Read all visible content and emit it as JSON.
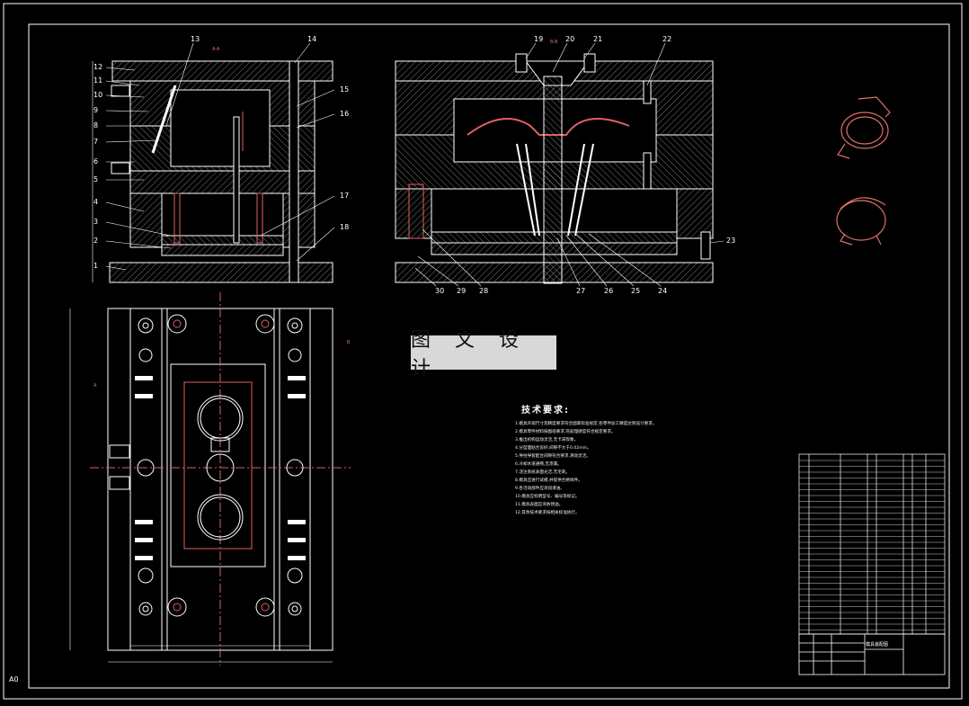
{
  "watermark": "图 文 设 计",
  "tech_requirements": {
    "title": "技术要求:",
    "items": [
      "1.模具外观尺寸及精度要求符合国家标准规定,各零件加工精度达到设计要求。",
      "2.模具零件材料按图纸要求,热处理硬度符合规定要求。",
      "3.推出机构运动灵活,无卡滞现象。",
      "4.分型面贴合良好,间隙不大于0.02mm。",
      "5.导柱导套配合间隙符合要求,滑动灵活。",
      "6.冷却水道通畅,无渗漏。",
      "7.浇注系统表面光洁,无毛刺。",
      "8.模具应进行试模,并提供合格样件。",
      "9.各活动部件应涂润滑油。",
      "10.模具应标明型号、编号等标记。",
      "11.模具表面应涂防锈油。",
      "12.其余技术要求按相关标准执行。"
    ]
  },
  "part_labels_top_left": [
    "1",
    "2",
    "3",
    "4",
    "5",
    "6",
    "7",
    "8",
    "9",
    "10",
    "11",
    "12",
    "13",
    "14",
    "15",
    "16",
    "17",
    "18"
  ],
  "part_labels_top_right": [
    "19",
    "20",
    "21",
    "22",
    "23",
    "24",
    "25",
    "26",
    "27",
    "28",
    "29",
    "30"
  ],
  "section_marks": [
    "A-A",
    "B-B",
    "A",
    "B"
  ],
  "title_block": {
    "name": "模具装配图"
  },
  "sheet_size": "A0",
  "colors": {
    "background": "#000000",
    "line": "#ffffff",
    "accent": "#e04040",
    "part": "#e0706a",
    "hatch": "#bbbbbb"
  }
}
